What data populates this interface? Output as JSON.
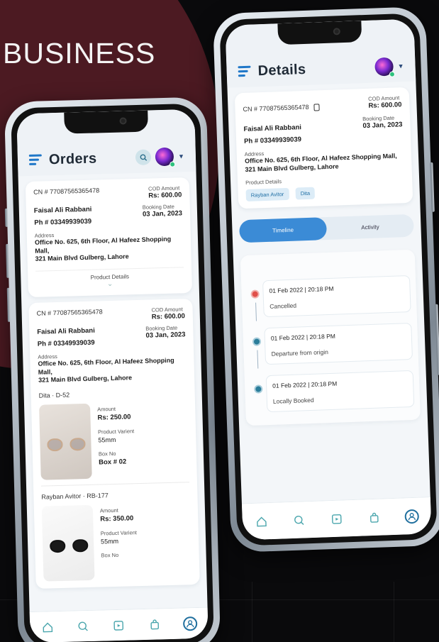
{
  "hero": {
    "title": "BUSINESS"
  },
  "orders_screen": {
    "title": "Orders",
    "cards": [
      {
        "cn": "CN # 77087565365478",
        "cod_label": "COD Amount",
        "cod_value": "Rs: 600.00",
        "name": "Faisal Ali Rabbani",
        "phone": "Ph # 03349939039",
        "booking_label": "Booking Date",
        "booking_value": "03 Jan, 2023",
        "address_label": "Address",
        "address_line1": "Office No. 625, 6th Floor, Al Hafeez Shopping Mall,",
        "address_line2": "321 Main Blvd Gulberg, Lahore",
        "product_details_label": "Product Details"
      },
      {
        "cn": "CN # 77087565365478",
        "cod_label": "COD Amount",
        "cod_value": "Rs: 600.00",
        "name": "Faisal Ali Rabbani",
        "phone": "Ph # 03349939039",
        "booking_label": "Booking Date",
        "booking_value": "03 Jan, 2023",
        "address_label": "Address",
        "address_line1": "Office No. 625, 6th Floor, Al Hafeez Shopping Mall,",
        "address_line2": "321 Main Blvd Gulberg, Lahore",
        "products": [
          {
            "heading": "Dita  ·  D-52",
            "amount_label": "Amount",
            "amount_value": "Rs: 250.00",
            "variant_label": "Product Varient",
            "variant_value": "55mm",
            "box_label": "Box No",
            "box_value": "Box # 02"
          },
          {
            "heading": "Rayban Avitor  ·  RB-177",
            "amount_label": "Amount",
            "amount_value": "Rs: 350.00",
            "variant_label": "Product Varient",
            "variant_value": "55mm",
            "box_label": "Box No"
          }
        ]
      }
    ]
  },
  "details_screen": {
    "title": "Details",
    "card": {
      "cn": "CN # 77087565365478",
      "cod_label": "COD Amount",
      "cod_value": "Rs: 600.00",
      "name": "Faisal Ali Rabbani",
      "phone": "Ph # 03349939039",
      "booking_label": "Booking Date",
      "booking_value": "03 Jan, 2023",
      "address_label": "Address",
      "address_line1": "Office No. 625, 6th Floor, Al Hafeez Shopping Mall,",
      "address_line2": "321 Main Blvd Gulberg, Lahore",
      "product_details_label": "Product Details",
      "chips": [
        "Rayban Avitor",
        "Dita"
      ]
    },
    "tabs": {
      "timeline": "Timeline",
      "activity": "Activity",
      "active": "timeline"
    },
    "timeline": [
      {
        "date": "01 Feb 2022 | 20:18 PM",
        "status": "Cancelled",
        "color": "#e0504a"
      },
      {
        "date": "01 Feb 2022 | 20:18 PM",
        "status": "Departure from origin",
        "color": "#2a7d9a"
      },
      {
        "date": "01 Feb 2022 | 20:18 PM",
        "status": "Locally Booked",
        "color": "#2a7d9a"
      }
    ]
  },
  "nav_icons": [
    "home-icon",
    "search-icon",
    "media-icon",
    "bag-icon",
    "profile-icon"
  ],
  "colors": {
    "accent": "#3b8bd6",
    "brand_dark": "#1f6f9e",
    "teal": "#4aa6ad",
    "danger": "#e0504a"
  }
}
